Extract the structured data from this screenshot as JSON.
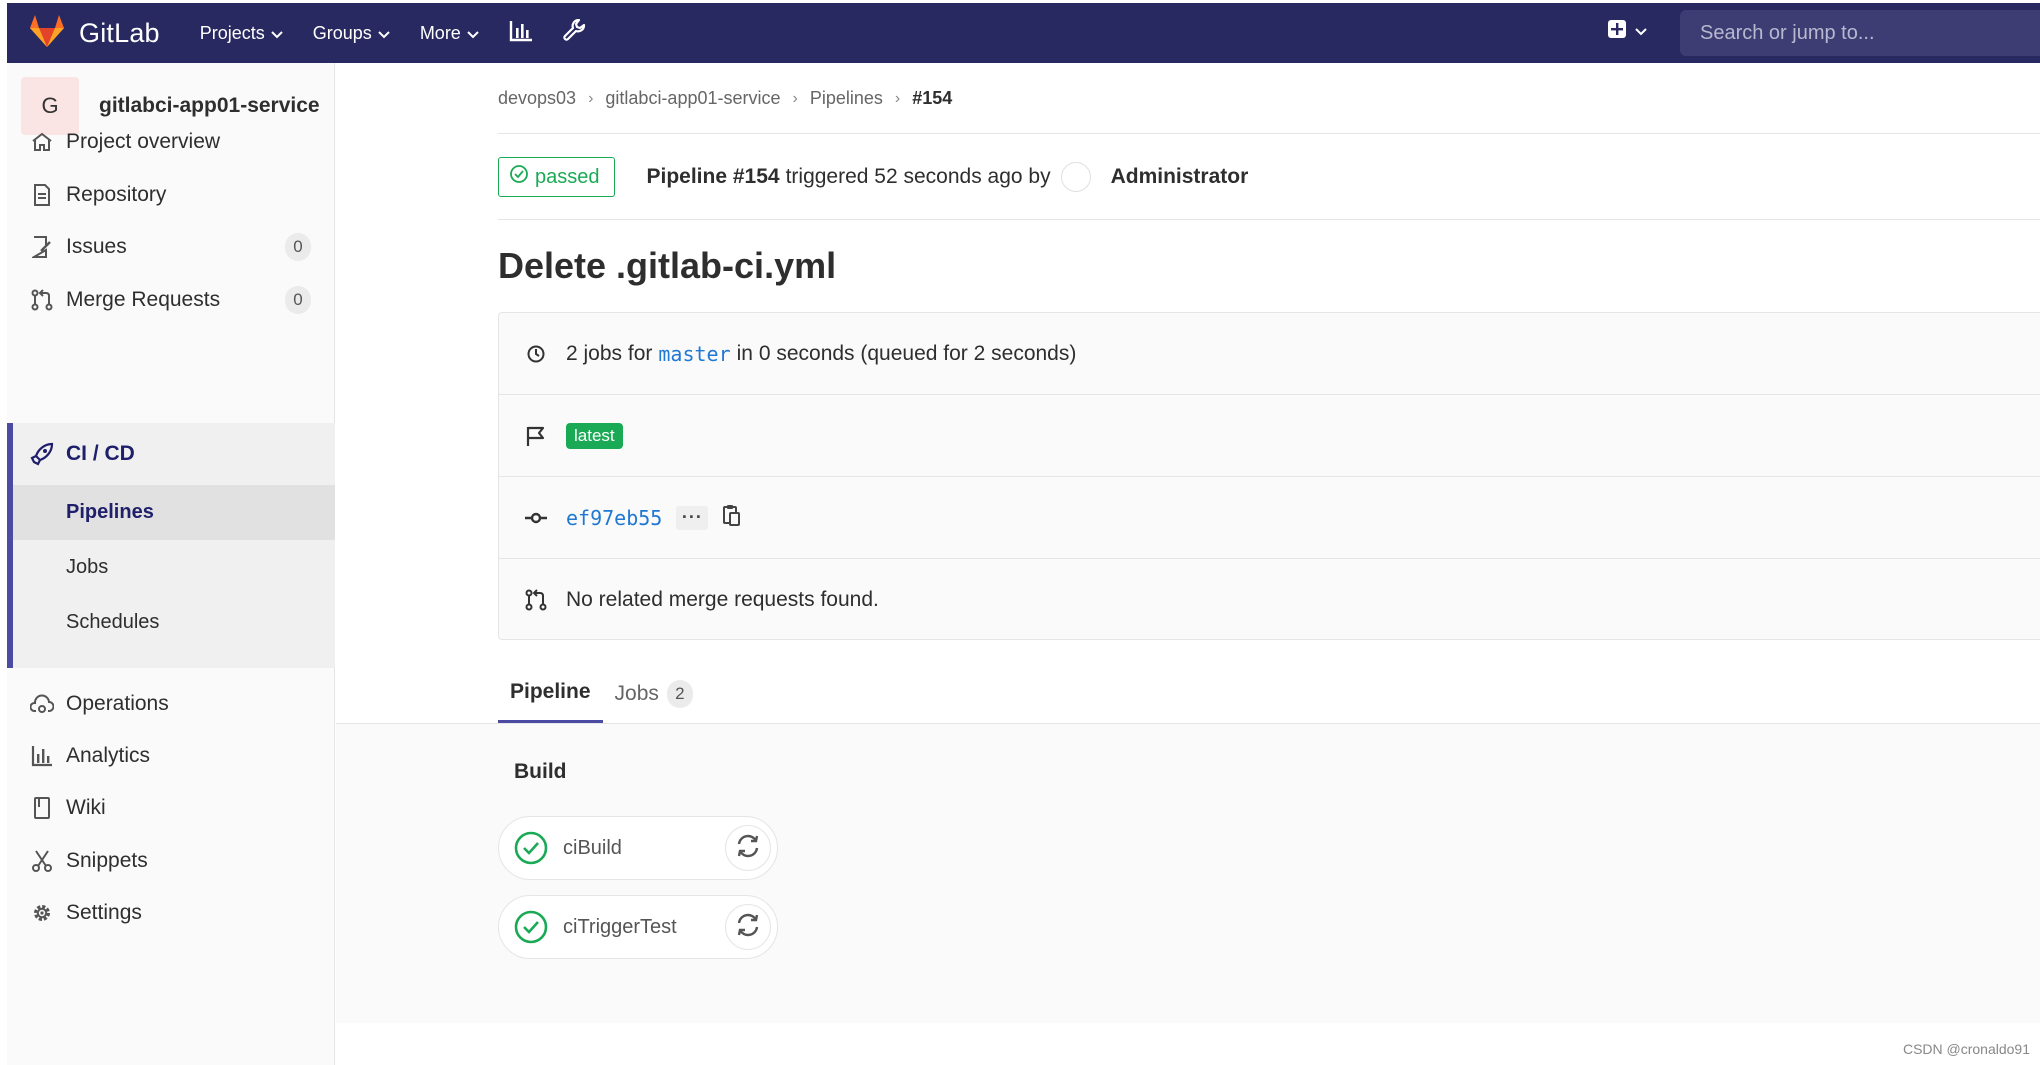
{
  "navbar": {
    "brand": "GitLab",
    "projects": "Projects",
    "groups": "Groups",
    "more": "More",
    "search_placeholder": "Search or jump to..."
  },
  "sidebar": {
    "project_initial": "G",
    "project_name": "gitlabci-app01-service",
    "items": [
      {
        "label": "Project overview"
      },
      {
        "label": "Repository"
      },
      {
        "label": "Issues",
        "count": "0"
      },
      {
        "label": "Merge Requests",
        "count": "0"
      },
      {
        "label": "CI / CD"
      },
      {
        "label": "Operations"
      },
      {
        "label": "Analytics"
      },
      {
        "label": "Wiki"
      },
      {
        "label": "Snippets"
      },
      {
        "label": "Settings"
      }
    ],
    "cicd_sub": [
      "Pipelines",
      "Jobs",
      "Schedules"
    ]
  },
  "breadcrumb": [
    "devops03",
    "gitlabci-app01-service",
    "Pipelines",
    "#154"
  ],
  "pipeline": {
    "status": "passed",
    "title": "Pipeline #154",
    "triggered": "triggered 52 seconds ago by",
    "user": "Administrator",
    "commit_title": "Delete .gitlab-ci.yml",
    "jobs_text_1": "2 jobs for",
    "branch": "master",
    "jobs_text_2": "in 0 seconds (queued for 2 seconds)",
    "latest": "latest",
    "sha": "ef97eb55",
    "more": "···",
    "mr_text": "No related merge requests found."
  },
  "tabs": {
    "pipeline": "Pipeline",
    "jobs": "Jobs",
    "jobs_count": "2"
  },
  "graph": {
    "stage": "Build",
    "jobs": [
      "ciBuild",
      "ciTriggerTest"
    ]
  },
  "watermark": "CSDN @cronaldo91",
  "colors": {
    "navbar": "#292961",
    "success": "#1aaa55",
    "link": "#1f78d1",
    "accent": "#4b4ba3"
  }
}
